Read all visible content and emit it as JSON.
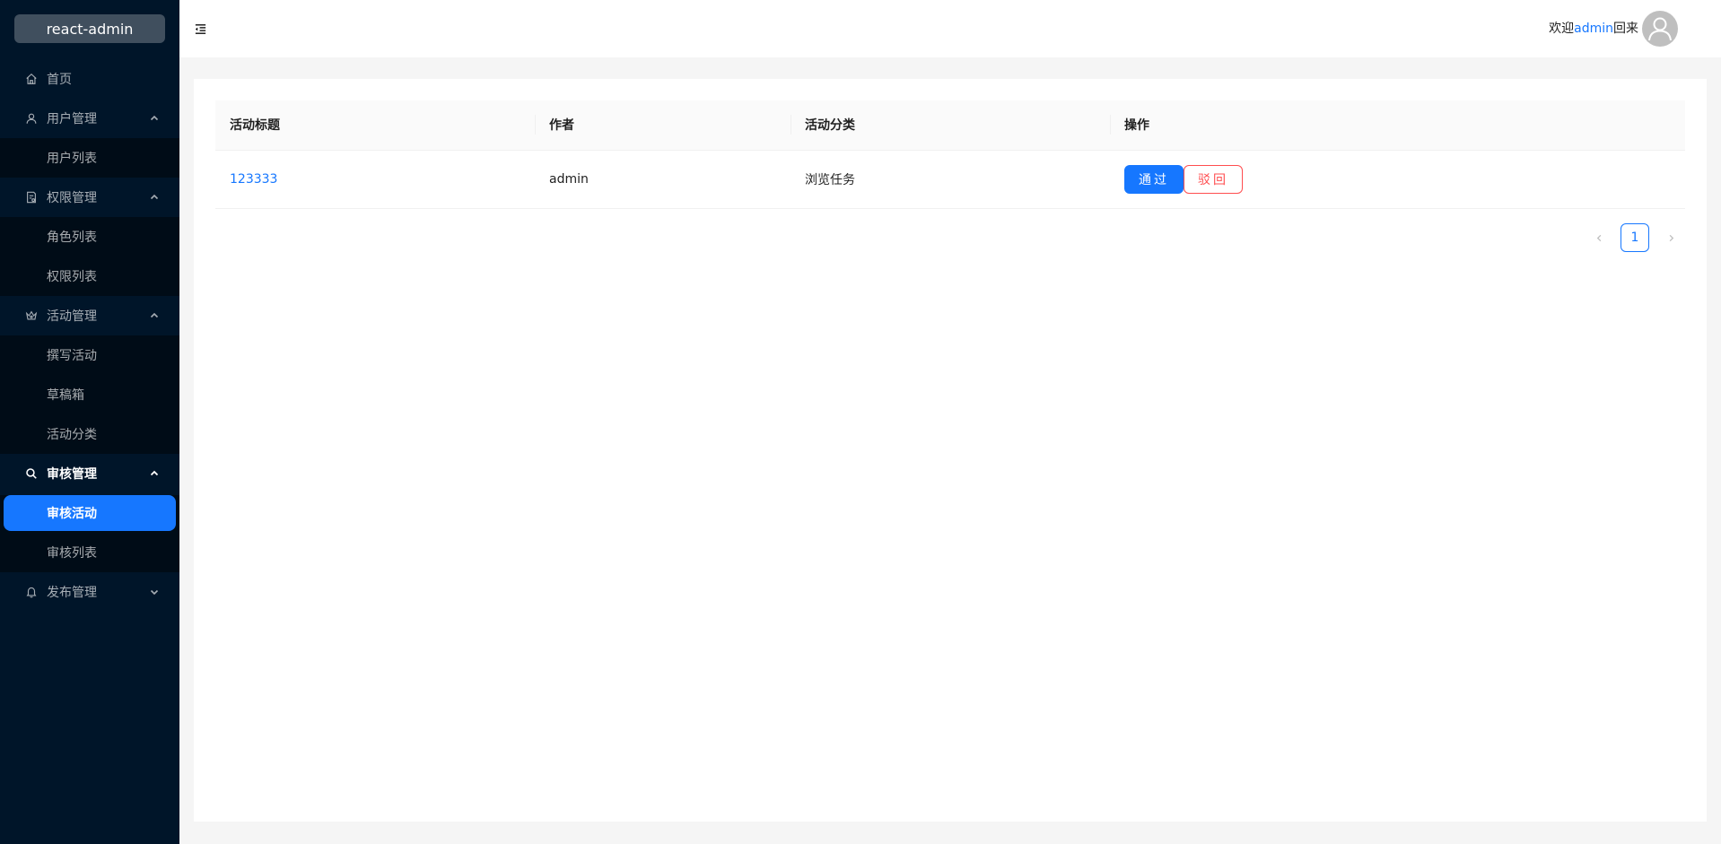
{
  "app": {
    "logo_text": "react-admin"
  },
  "colors": {
    "sider_bg": "#001529",
    "submenu_bg": "#000c17",
    "primary": "#1677ff",
    "danger": "#ff4d4f"
  },
  "sidebar": {
    "home": {
      "label": "首页",
      "icon": "home-icon"
    },
    "users": {
      "label": "用户管理",
      "icon": "user-icon",
      "expanded": true,
      "items": [
        {
          "label": "用户列表"
        }
      ]
    },
    "rights": {
      "label": "权限管理",
      "icon": "audit-icon",
      "expanded": true,
      "items": [
        {
          "label": "角色列表"
        },
        {
          "label": "权限列表"
        }
      ]
    },
    "activity": {
      "label": "活动管理",
      "icon": "crown-icon",
      "expanded": true,
      "items": [
        {
          "label": "撰写活动"
        },
        {
          "label": "草稿箱"
        },
        {
          "label": "活动分类"
        }
      ]
    },
    "audit": {
      "label": "审核管理",
      "icon": "search-icon",
      "expanded": true,
      "items": [
        {
          "label": "审核活动",
          "selected": true
        },
        {
          "label": "审核列表"
        }
      ]
    },
    "publish": {
      "label": "发布管理",
      "icon": "bell-icon",
      "expanded": false
    }
  },
  "header": {
    "welcome_prefix": "欢迎",
    "username": "admin",
    "welcome_suffix": "回来"
  },
  "table": {
    "columns": [
      "活动标题",
      "作者",
      "活动分类",
      "操作"
    ],
    "rows": [
      {
        "title": "123333",
        "author": "admin",
        "category": "浏览任务",
        "approve_label": "通过",
        "reject_label": "驳回"
      }
    ]
  },
  "pagination": {
    "current_page": "1"
  }
}
